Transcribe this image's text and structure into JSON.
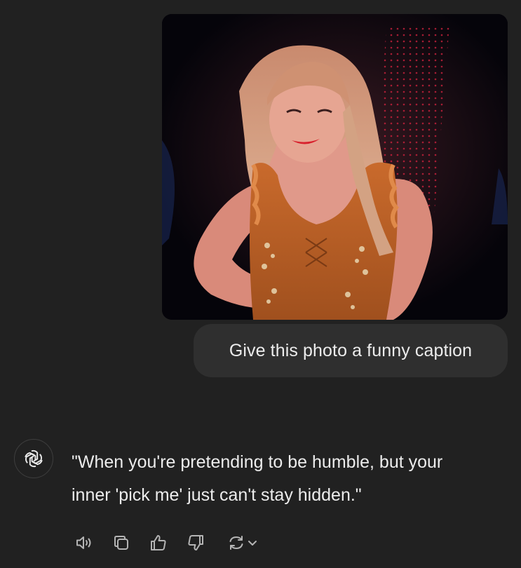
{
  "conversation": {
    "user_message": {
      "attachment_alt": "concert photo",
      "text": "Give this photo a funny caption"
    },
    "assistant_message": {
      "avatar_icon": "openai-logo-icon",
      "lines": [
        "\"When you're pretending to be humble, but your",
        "inner 'pick me' just can't stay hidden.\""
      ]
    },
    "actions": [
      {
        "icon": "speaker-icon"
      },
      {
        "icon": "copy-icon"
      },
      {
        "icon": "thumbs-up-icon"
      },
      {
        "icon": "thumbs-down-icon"
      },
      {
        "icon": "regenerate-icon"
      }
    ]
  },
  "colors": {
    "background": "#212121",
    "bubble": "#2f2f2f",
    "text": "#ececec",
    "icon": "#b4b4b4"
  }
}
